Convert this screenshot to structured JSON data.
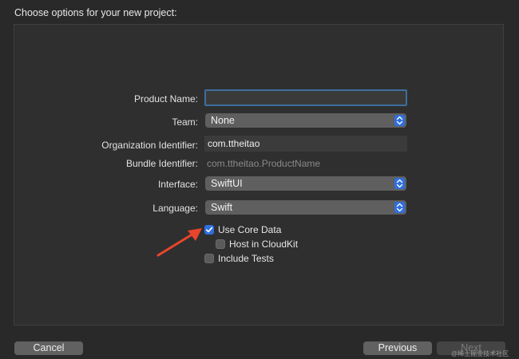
{
  "header": {
    "title": "Choose options for your new project:"
  },
  "form": {
    "product_name": {
      "label": "Product Name:",
      "value": ""
    },
    "team": {
      "label": "Team:",
      "value": "None"
    },
    "organization_identifier": {
      "label": "Organization Identifier:",
      "value": "com.ttheitao"
    },
    "bundle_identifier": {
      "label": "Bundle Identifier:",
      "value": "com.ttheitao.ProductName"
    },
    "interface": {
      "label": "Interface:",
      "value": "SwiftUI"
    },
    "language": {
      "label": "Language:",
      "value": "Swift"
    }
  },
  "options": {
    "use_core_data": {
      "label": "Use Core Data",
      "checked": true
    },
    "host_in_cloudkit": {
      "label": "Host in CloudKit",
      "checked": false
    },
    "include_tests": {
      "label": "Include Tests",
      "checked": false
    }
  },
  "footer": {
    "cancel_label": "Cancel",
    "previous_label": "Previous",
    "next_label": "Next"
  },
  "watermark": {
    "text": "@稀土掘金技术社区"
  },
  "colors": {
    "accent": "#2f6fe0",
    "focus_ring": "#3d6e9e",
    "arrow": "#e8452c",
    "background": "#292929",
    "panel": "#2f2f2f"
  },
  "icons": {
    "popup_stepper": "chevron-up-down-icon",
    "checkmark": "checkmark-icon",
    "annotation": "red-arrow-icon"
  }
}
